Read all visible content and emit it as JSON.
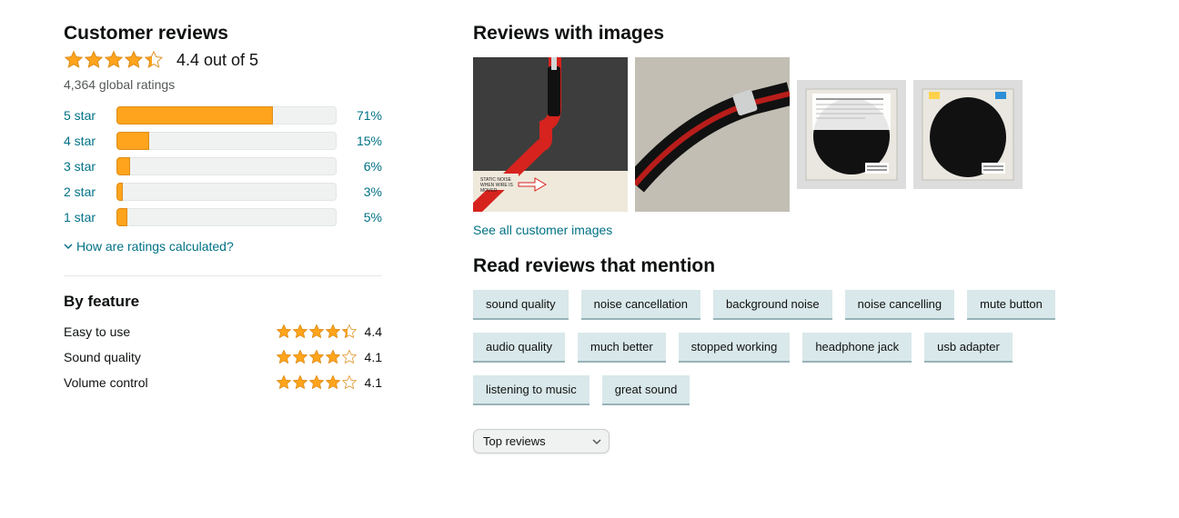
{
  "reviews": {
    "title": "Customer reviews",
    "overall_text": "4.4 out of 5",
    "overall_value": 4.4,
    "global_ratings": "4,364 global ratings",
    "histogram": [
      {
        "label": "5 star",
        "pct": 71,
        "pct_text": "71%"
      },
      {
        "label": "4 star",
        "pct": 15,
        "pct_text": "15%"
      },
      {
        "label": "3 star",
        "pct": 6,
        "pct_text": "6%"
      },
      {
        "label": "2 star",
        "pct": 3,
        "pct_text": "3%"
      },
      {
        "label": "1 star",
        "pct": 5,
        "pct_text": "5%"
      }
    ],
    "how_link": "How are ratings calculated?",
    "by_feature_title": "By feature",
    "features": [
      {
        "name": "Easy to use",
        "score": 4.4,
        "score_text": "4.4"
      },
      {
        "name": "Sound quality",
        "score": 4.1,
        "score_text": "4.1"
      },
      {
        "name": "Volume control",
        "score": 4.1,
        "score_text": "4.1"
      }
    ]
  },
  "images_section": {
    "title": "Reviews with images",
    "see_all": "See all customer images"
  },
  "mentions": {
    "title": "Read reviews that mention",
    "tags": [
      "sound quality",
      "noise cancellation",
      "background noise",
      "noise cancelling",
      "mute button",
      "audio quality",
      "much better",
      "stopped working",
      "headphone jack",
      "usb adapter",
      "listening to music",
      "great sound"
    ]
  },
  "sort": {
    "selected": "Top reviews"
  }
}
